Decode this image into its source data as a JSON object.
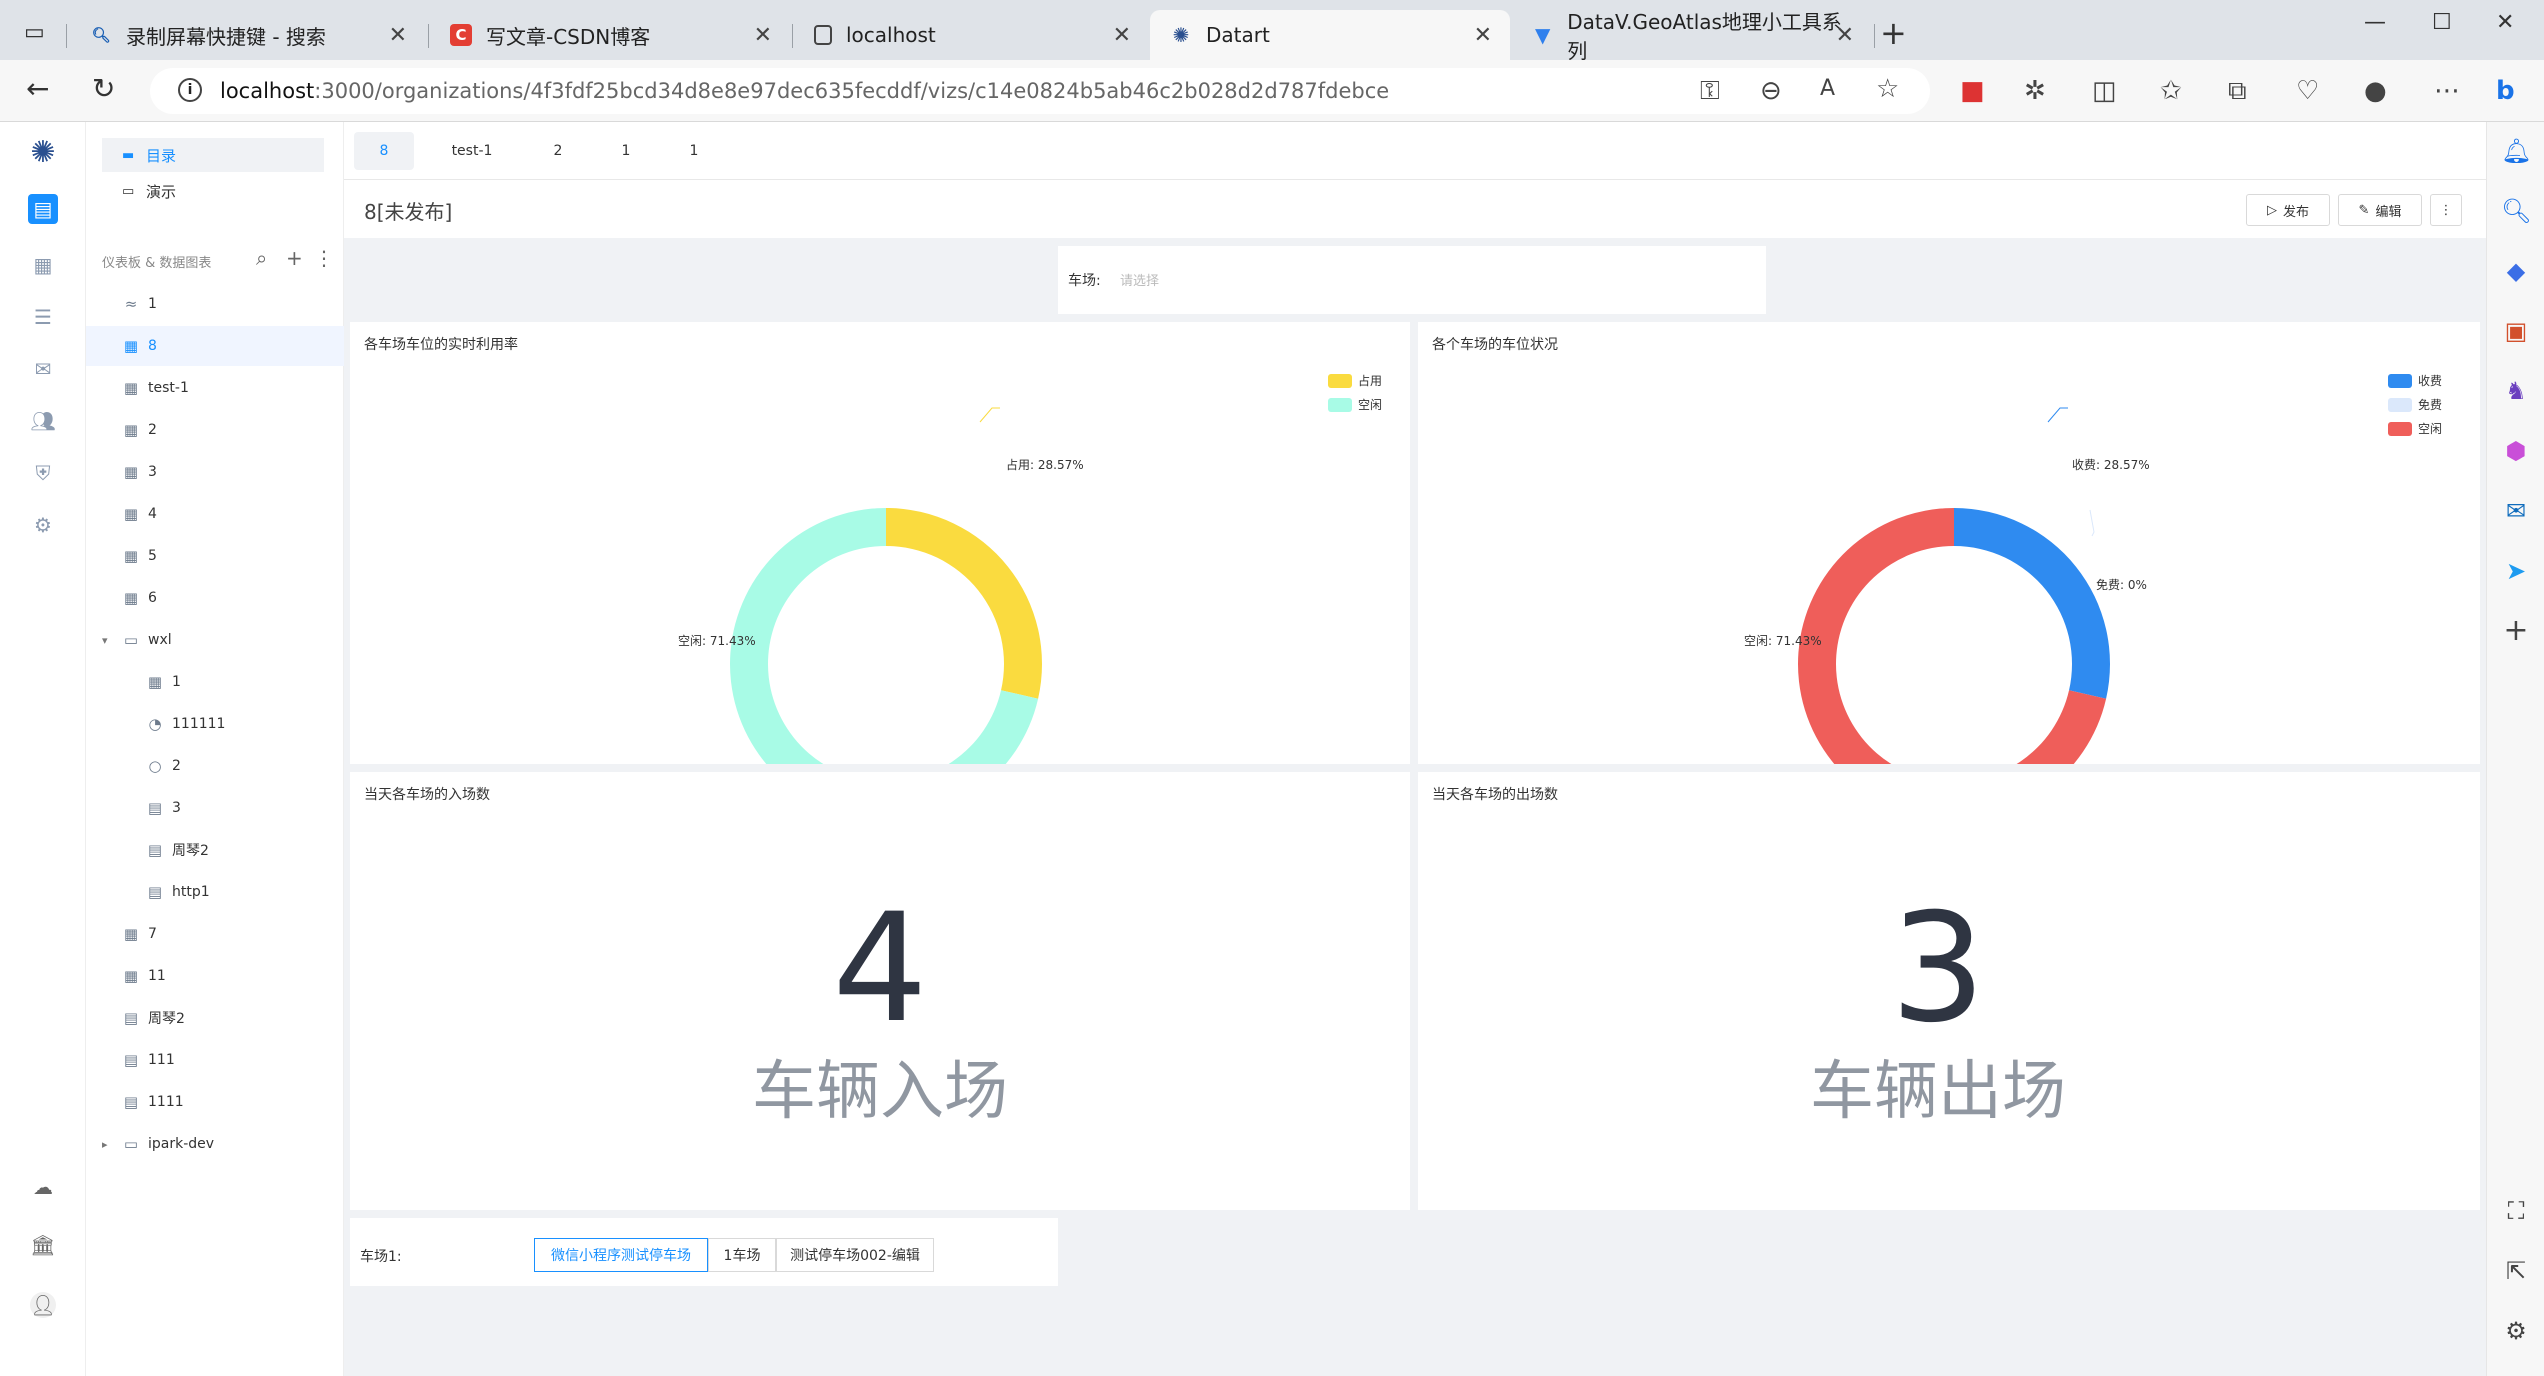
{
  "browser": {
    "tabs": [
      {
        "label": "录制屏幕快捷键 - 搜索",
        "favicon": "search-icon"
      },
      {
        "label": "写文章-CSDN博客",
        "favicon": "csdn-icon"
      },
      {
        "label": "localhost",
        "favicon": "page-icon"
      },
      {
        "label": "Datart",
        "favicon": "datart-icon"
      },
      {
        "label": "DataV.GeoAtlas地理小工具系列",
        "favicon": "datav-icon"
      }
    ],
    "url_host": "localhost",
    "url_rest": ":3000/organizations/4f3fdf25bcd34d8e8e97dec635fecddf/vizs/c14e0824b5ab46c2b028d2d787fdebce"
  },
  "switcher": {
    "items": [
      {
        "label": "目录"
      },
      {
        "label": "演示"
      }
    ]
  },
  "tree": {
    "title": "仪表板 & 数据图表",
    "rows": [
      {
        "label": "1",
        "icon": "chart-icon"
      },
      {
        "label": "8",
        "icon": "dashboard-icon"
      },
      {
        "label": "test-1",
        "icon": "dashboard-icon"
      },
      {
        "label": "2",
        "icon": "dashboard-icon"
      },
      {
        "label": "3",
        "icon": "dashboard-icon"
      },
      {
        "label": "4",
        "icon": "dashboard-icon"
      },
      {
        "label": "5",
        "icon": "dashboard-icon"
      },
      {
        "label": "6",
        "icon": "dashboard-icon"
      },
      {
        "label": "wxl",
        "icon": "folder-icon"
      },
      {
        "label": "1",
        "icon": "dashboard-icon"
      },
      {
        "label": "111111",
        "icon": "pie-icon"
      },
      {
        "label": "2",
        "icon": "ring-icon"
      },
      {
        "label": "3",
        "icon": "table-icon"
      },
      {
        "label": "周琴2",
        "icon": "table-icon"
      },
      {
        "label": "http1",
        "icon": "table-icon"
      },
      {
        "label": "7",
        "icon": "dashboard-icon"
      },
      {
        "label": "11",
        "icon": "dashboard-icon"
      },
      {
        "label": "周琴2",
        "icon": "table-icon"
      },
      {
        "label": "111",
        "icon": "table-icon"
      },
      {
        "label": "1111",
        "icon": "table-icon"
      },
      {
        "label": "ipark-dev",
        "icon": "folder-icon"
      }
    ]
  },
  "dash_tabs": [
    "8",
    "test-1",
    "2",
    "1",
    "1"
  ],
  "dashboard": {
    "title": "8[未发布]",
    "publish_label": "发布",
    "edit_label": "编辑",
    "filter_label": "车场:",
    "filter_placeholder": "请选择",
    "lot_label": "车场1:",
    "lot_options": [
      "微信小程序测试停车场",
      "1车场",
      "测试停车场002-编辑"
    ]
  },
  "chart_data": [
    {
      "type": "pie",
      "title": "各车场车位的实时利用率",
      "legend": [
        "占用",
        "空闲"
      ],
      "legend_position": "top-right",
      "slices": [
        {
          "name": "占用",
          "value": 28.57,
          "label": "占用: 28.57%",
          "color": "#fadb3f"
        },
        {
          "name": "空闲",
          "value": 71.43,
          "label": "空闲: 71.43%",
          "color": "#a8fbe6"
        }
      ]
    },
    {
      "type": "pie",
      "title": "各个车场的车位状况",
      "legend": [
        "收费",
        "免费",
        "空闲"
      ],
      "legend_position": "top-right",
      "slices": [
        {
          "name": "收费",
          "value": 28.57,
          "label": "收费: 28.57%",
          "color": "#2f8bf0"
        },
        {
          "name": "免费",
          "value": 0,
          "label": "免费: 0%",
          "color": "#dbe8fb"
        },
        {
          "name": "空闲",
          "value": 71.43,
          "label": "空闲: 71.43%",
          "color": "#ef5e5a"
        }
      ]
    },
    {
      "type": "table",
      "title": "当天各车场的入场数",
      "value": "4",
      "caption": "车辆入场"
    },
    {
      "type": "table",
      "title": "当天各车场的出场数",
      "value": "3",
      "caption": "车辆出场"
    }
  ]
}
